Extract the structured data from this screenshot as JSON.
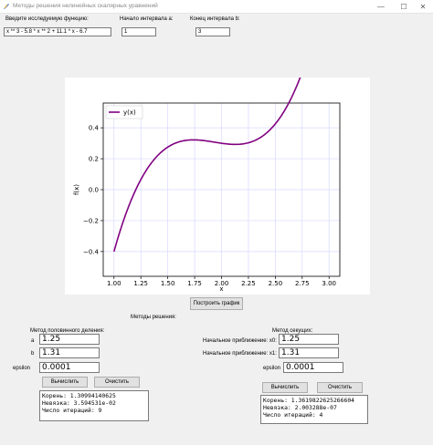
{
  "window": {
    "title": "Методы решения нелинейных скалярных уравнений",
    "minimize": "—",
    "maximize": "☐",
    "close": "✕"
  },
  "inputs": {
    "function_label": "Введите исследуемую функцию:",
    "function_value": "x ** 3 - 5.8 * x ** 2 + 11.1 * x - 6.7",
    "a_label": "Начало интервала a:",
    "a_value": "1",
    "b_label": "Конец интервала b:",
    "b_value": "3"
  },
  "chart_data": {
    "type": "line",
    "series": [
      {
        "name": "y(x)",
        "function": "x^3 - 5.8x^2 + 11.1x - 6.7",
        "x_range": [
          1,
          3
        ],
        "color": "#800080"
      }
    ],
    "xlabel": "x",
    "ylabel": "f(x)",
    "xlim": [
      0.9,
      3.1
    ],
    "ylim": [
      -0.56,
      0.56
    ],
    "xticks": [
      1.0,
      1.25,
      1.5,
      1.75,
      2.0,
      2.25,
      2.5,
      2.75,
      3.0
    ],
    "xtick_labels": [
      "1.00",
      "1.25",
      "1.50",
      "1.75",
      "2.00",
      "2.25",
      "2.50",
      "2.75",
      "3.00"
    ],
    "yticks": [
      -0.4,
      -0.2,
      0.0,
      0.2,
      0.4
    ],
    "ytick_labels": [
      "−0.4",
      "−0.2",
      "0.0",
      "0.2",
      "0.4"
    ],
    "grid": true,
    "legend": "top-left"
  },
  "plot_button": "Построить график",
  "methods_title": "Методы решения:",
  "bisection": {
    "title": "Метод половинного деления:",
    "a_label": "a",
    "a_value": "1.25",
    "b_label": "b",
    "b_value": "1.31",
    "eps_label": "epsilon",
    "eps_value": "0.0001",
    "compute": "Вычислить",
    "clear": "Очистить",
    "output": [
      "Корень: 1.30994140625",
      "Невязка: 3.594531e-02",
      "Число итераций: 9"
    ]
  },
  "secant": {
    "title": "Метод секущих:",
    "x0_label": "Начальное приближение: x0:",
    "x0_value": "1.25",
    "x1_label": "Начальное приближение: x1:",
    "x1_value": "1.31",
    "eps_label": "epsilon",
    "eps_value": "0.0001",
    "compute": "Вычислить",
    "clear": "Очистить",
    "output": [
      "Корень: 1.3619822625266604",
      "Невязка: 2.003288e-07",
      "Число итераций: 4"
    ]
  }
}
